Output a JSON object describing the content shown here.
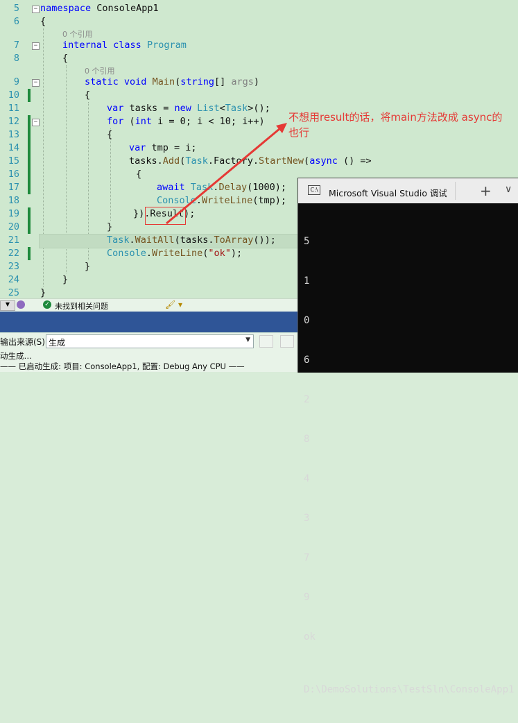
{
  "editor": {
    "line_numbers": [
      "5",
      "6",
      "7",
      "8",
      "9",
      "10",
      "11",
      "12",
      "13",
      "14",
      "15",
      "16",
      "17",
      "18",
      "19",
      "20",
      "21",
      "22",
      "23",
      "24",
      "25"
    ],
    "ref_label": "0 个引用",
    "lines": {
      "l5_kw": "namespace",
      "l5_name": " ConsoleApp1",
      "l6": "{",
      "l7_kw1": "internal",
      "l7_kw2": "class",
      "l7_ty": "Program",
      "l8": "{",
      "l9_kw1": "static",
      "l9_kw2": "void",
      "l9_fn": "Main",
      "l9_p1": "(",
      "l9_kw3": "string",
      "l9_p2": "[] ",
      "l9_par": "args",
      "l9_p3": ")",
      "l10": "{",
      "l11_kw1": "var",
      "l11_a": " tasks = ",
      "l11_kw2": "new",
      "l11_ty1": "List",
      "l11_b": "<",
      "l11_ty2": "Task",
      "l11_c": ">();",
      "l12_kw1": "for",
      "l12_a": " (",
      "l12_kw2": "int",
      "l12_b": " i = 0; i < 10; i++)",
      "l13": "{",
      "l14_kw": "var",
      "l14_a": " tmp = i;",
      "l15_a": "tasks.",
      "l15_fn1": "Add",
      "l15_b": "(",
      "l15_ty": "Task",
      "l15_c": ".",
      "l15_d": "Factory",
      "l15_e": ".",
      "l15_fn2": "StartNew",
      "l15_f": "(",
      "l15_kw": "async",
      "l15_g": " () =>",
      "l16": "{",
      "l17_kw": "await",
      "l17_ty": "Task",
      "l17_a": ".",
      "l17_fn": "Delay",
      "l17_b": "(1000);",
      "l18_ty": "Console",
      "l18_a": ".",
      "l18_fn": "WriteLine",
      "l18_b": "(tmp);",
      "l19_a": "}).",
      "l19_b": "Result",
      "l19_c": ");",
      "l20": "}",
      "l21_ty": "Task",
      "l21_a": ".",
      "l21_fn1": "WaitAll",
      "l21_b": "(tasks.",
      "l21_fn2": "ToArray",
      "l21_c": "());",
      "l22_ty": "Console",
      "l22_a": ".",
      "l22_fn": "WriteLine",
      "l22_b": "(",
      "l22_str": "\"ok\"",
      "l22_c": ");",
      "l23": "}",
      "l24": "}",
      "l25": "}"
    }
  },
  "annotation": {
    "text_line1": "不想用result的话，将main方法改成 async的",
    "text_line2": "也行",
    "color": "#e53935"
  },
  "statusbar": {
    "issues": "未找到相关问题"
  },
  "output_panel": {
    "source_label": "输出来源(S):",
    "source_value": "生成",
    "line1": "动生成…",
    "line2": "—— 已启动生成: 项目: ConsoleApp1, 配置: Debug Any CPU ——"
  },
  "console": {
    "title": "Microsoft Visual Studio 调试控制",
    "lines": [
      "5",
      "1",
      "0",
      "6",
      "2",
      "8",
      "4",
      "3",
      "7",
      "9",
      "ok"
    ],
    "path": "D:\\DemoSolutions\\TestSln\\ConsoleApp1"
  }
}
